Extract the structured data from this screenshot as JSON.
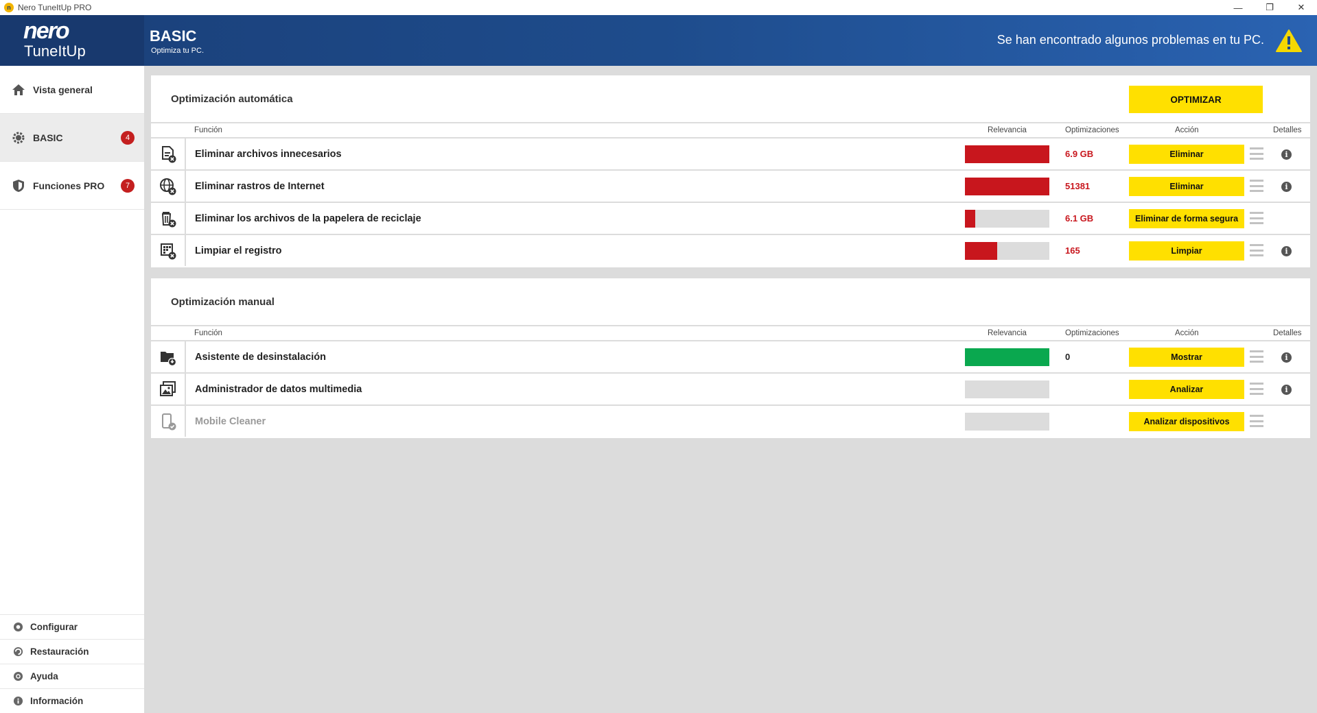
{
  "window": {
    "title": "Nero TuneItUp PRO",
    "minimize_icon": "minimize-icon",
    "restore_icon": "restore-icon",
    "close_icon": "close-icon"
  },
  "header": {
    "logo_brand": "nero",
    "logo_product": "TuneItUp",
    "title": "BASIC",
    "subtitle": "Optimiza tu PC.",
    "warning": "Se han encontrado algunos problemas en tu PC.",
    "warning_color": "#f5d800"
  },
  "sidebar": {
    "items": [
      {
        "label": "Vista general",
        "icon": "home-icon"
      },
      {
        "label": "BASIC",
        "icon": "gear-icon",
        "badge": "4"
      },
      {
        "label": "Funciones PRO",
        "icon": "shield-icon",
        "badge": "7"
      }
    ],
    "bottom": [
      {
        "label": "Configurar",
        "icon": "gear-icon"
      },
      {
        "label": "Restauración",
        "icon": "restore-icon"
      },
      {
        "label": "Ayuda",
        "icon": "help-icon"
      },
      {
        "label": "Información",
        "icon": "info-icon"
      }
    ]
  },
  "auto": {
    "title": "Optimización automática",
    "optimize_button": "OPTIMIZAR",
    "columns": {
      "function": "Función",
      "relevance": "Relevancia",
      "optimizations": "Optimizaciones",
      "action": "Acción",
      "details": "Detalles"
    },
    "rows": [
      {
        "name": "Eliminar archivos innecesarios",
        "icon": "file-delete-icon",
        "relevance": 1.0,
        "relevance_color": "#c8161d",
        "value": "6.9 GB",
        "action": "Eliminar",
        "info": true
      },
      {
        "name": "Eliminar rastros de Internet",
        "icon": "globe-delete-icon",
        "relevance": 1.0,
        "relevance_color": "#c8161d",
        "value": "51381",
        "action": "Eliminar",
        "info": true
      },
      {
        "name": "Eliminar los archivos de la papelera de reciclaje",
        "icon": "trash-delete-icon",
        "relevance": 0.12,
        "relevance_color": "#c8161d",
        "value": "6.1 GB",
        "action": "Eliminar de forma segura",
        "info": false
      },
      {
        "name": "Limpiar el registro",
        "icon": "registry-delete-icon",
        "relevance": 0.38,
        "relevance_color": "#c8161d",
        "value": "165",
        "action": "Limpiar",
        "info": true
      }
    ]
  },
  "manual": {
    "title": "Optimización manual",
    "columns": {
      "function": "Función",
      "relevance": "Relevancia",
      "optimizations": "Optimizaciones",
      "action": "Acción",
      "details": "Detalles"
    },
    "rows": [
      {
        "name": "Asistente de desinstalación",
        "icon": "uninstall-folder-icon",
        "relevance": 1.0,
        "relevance_color": "#0aa84f",
        "value": "0",
        "action": "Mostrar",
        "info": true
      },
      {
        "name": "Administrador de datos multimedia",
        "icon": "media-icon",
        "relevance": 0,
        "relevance_color": "#dcdcdc",
        "value": "",
        "action": "Analizar",
        "info": true
      },
      {
        "name": "Mobile Cleaner",
        "icon": "mobile-icon",
        "relevance": 0,
        "relevance_color": "#dcdcdc",
        "value": "",
        "action": "Analizar dispositivos",
        "info": false,
        "disabled": true
      }
    ]
  },
  "colors": {
    "accent_yellow": "#ffe000",
    "header_blue": "#1e4c8c",
    "red": "#c8161d",
    "green": "#0aa84f"
  }
}
